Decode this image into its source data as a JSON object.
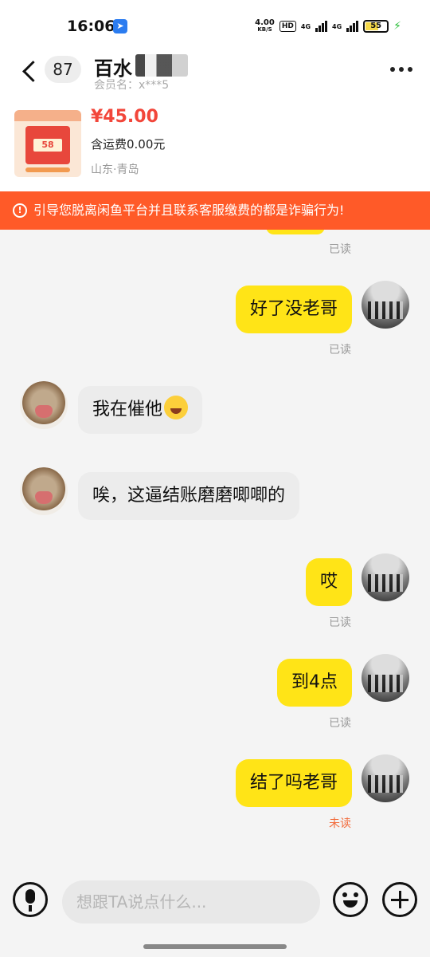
{
  "status_bar": {
    "time": "16:06",
    "net_speed_value": "4.00",
    "net_speed_unit": "KB/S",
    "hd_label": "HD",
    "network_1": "4G",
    "network_2": "4G",
    "battery": "55"
  },
  "header": {
    "unread_count": "87",
    "nickname": "百水",
    "member_label": "会员名：x***5"
  },
  "product": {
    "price": "¥45.00",
    "shipping": "含运费0.00元",
    "location": "山东·青岛"
  },
  "warning": {
    "text": "引导您脱离闲鱼平台并且联系客服缴费的都是诈骗行为!"
  },
  "messages": [
    {
      "from": "me",
      "text": "",
      "status": "已读"
    },
    {
      "from": "me",
      "text": "好了没老哥",
      "status": "已读"
    },
    {
      "from": "them",
      "text": "我在催他",
      "emoji": "crying-laugh-emoji"
    },
    {
      "from": "them",
      "text": "唉，这逼结账磨磨唧唧的"
    },
    {
      "from": "me",
      "text": "哎",
      "status": "已读"
    },
    {
      "from": "me",
      "text": "到4点",
      "status": "已读"
    },
    {
      "from": "me",
      "text": "结了吗老哥",
      "status": "未读"
    }
  ],
  "input": {
    "placeholder": "想跟TA说点什么..."
  },
  "colors": {
    "my_bubble": "#ffe417",
    "their_bubble": "#ececec",
    "warning_bg": "#ff5a28",
    "price": "#f2463a",
    "unread_status": "#f26a3a"
  }
}
